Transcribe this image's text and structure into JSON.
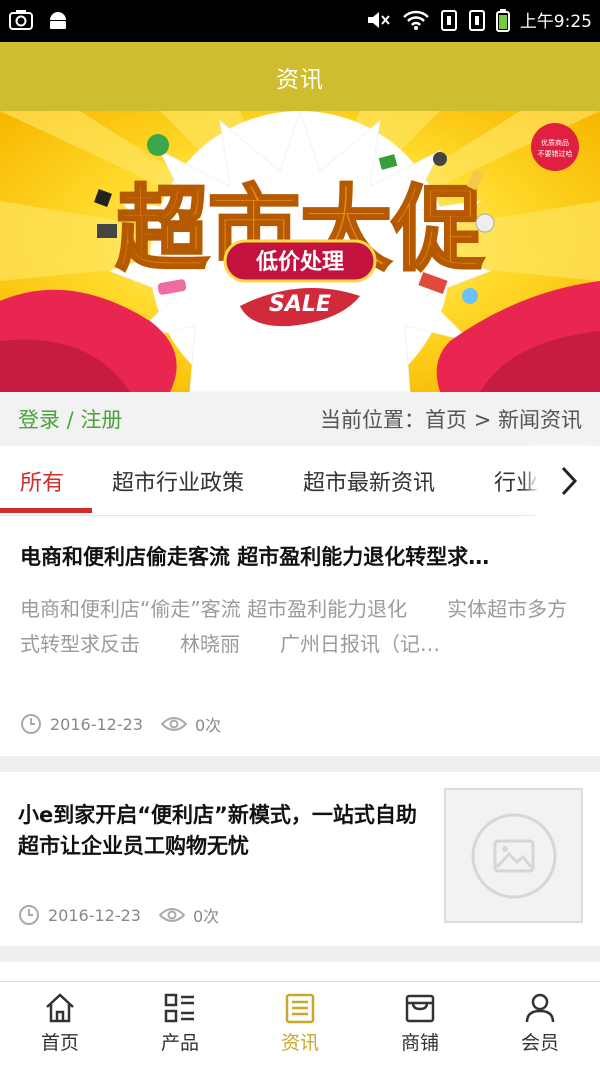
{
  "status_bar": {
    "time": "上午9:25"
  },
  "header": {
    "title": "资讯"
  },
  "banner": {
    "headline": "超市大促",
    "sub": "低价处理",
    "sale": "SALE",
    "badge_line1": "优质商品",
    "badge_line2": "不要错过哈"
  },
  "location": {
    "login": "登录 / 注册",
    "breadcrumb": "当前位置：首页 > 新闻资讯"
  },
  "tabs": [
    "所有",
    "超市行业政策",
    "超市最新资讯",
    "行业"
  ],
  "articles": [
    {
      "title": "电商和便利店偷走客流 超市盈利能力退化转型求…",
      "summary": "电商和便利店“偷走”客流 超市盈利能力退化　　实体超市多方式转型求反击　　林晓丽　　广州日报讯（记…",
      "date": "2016-12-23",
      "views": "0次"
    },
    {
      "title": "小e到家开启“便利店”新模式，一站式自助超市让企业员工购物无忧",
      "date": "2016-12-23",
      "views": "0次"
    }
  ],
  "nav": [
    "首页",
    "产品",
    "资讯",
    "商铺",
    "会员"
  ],
  "colors": {
    "header": "#cdbd2f",
    "active_tab": "#d12b2b",
    "active_nav": "#c9a72a",
    "login": "#4aa33a"
  }
}
